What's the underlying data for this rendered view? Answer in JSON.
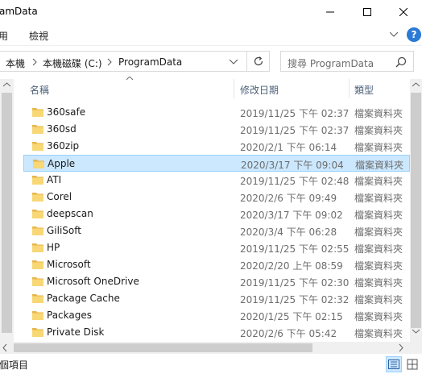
{
  "window": {
    "title": "amData",
    "minimize_label": "—",
    "maximize_label": "□",
    "close_label": "✕"
  },
  "ribbon": {
    "tabs": [
      "用",
      "檢視"
    ],
    "help_label": "?"
  },
  "address": {
    "crumbs": [
      "本機",
      "本機磁碟 (C:)",
      "ProgramData"
    ]
  },
  "search": {
    "placeholder": "搜尋 ProgramData"
  },
  "columns": {
    "name": "名稱",
    "date": "修改日期",
    "type": "類型"
  },
  "files": [
    {
      "name": "360safe",
      "date": "2019/11/25 下午 02:37",
      "type": "檔案資料夾",
      "selected": false
    },
    {
      "name": "360sd",
      "date": "2019/11/25 下午 02:37",
      "type": "檔案資料夾",
      "selected": false
    },
    {
      "name": "360zip",
      "date": "2020/2/1 下午 06:14",
      "type": "檔案資料夾",
      "selected": false
    },
    {
      "name": "Apple",
      "date": "2020/3/17 下午 09:04",
      "type": "檔案資料夾",
      "selected": true
    },
    {
      "name": "ATI",
      "date": "2019/11/25 下午 02:48",
      "type": "檔案資料夾",
      "selected": false
    },
    {
      "name": "Corel",
      "date": "2020/2/6 下午 09:49",
      "type": "檔案資料夾",
      "selected": false
    },
    {
      "name": "deepscan",
      "date": "2020/3/17 下午 09:02",
      "type": "檔案資料夾",
      "selected": false
    },
    {
      "name": "GiliSoft",
      "date": "2020/3/4 下午 06:28",
      "type": "檔案資料夾",
      "selected": false
    },
    {
      "name": "HP",
      "date": "2019/11/25 下午 02:55",
      "type": "檔案資料夾",
      "selected": false
    },
    {
      "name": "Microsoft",
      "date": "2020/2/20 上午 08:59",
      "type": "檔案資料夾",
      "selected": false
    },
    {
      "name": "Microsoft OneDrive",
      "date": "2019/11/25 下午 02:30",
      "type": "檔案資料夾",
      "selected": false
    },
    {
      "name": "Package Cache",
      "date": "2019/11/25 下午 02:32",
      "type": "檔案資料夾",
      "selected": false
    },
    {
      "name": "Packages",
      "date": "2020/1/25 下午 02:15",
      "type": "檔案資料夾",
      "selected": false
    },
    {
      "name": "Private Disk",
      "date": "2020/2/6 下午 05:42",
      "type": "檔案資料夾",
      "selected": false
    }
  ],
  "status": {
    "text": "個項目"
  },
  "icons": {
    "folder": "folder-icon",
    "search": "search-icon",
    "refresh": "refresh-icon",
    "chevron": "chevron-down-icon",
    "details_view": "details-view-icon",
    "large_icons_view": "large-icons-view-icon"
  },
  "colors": {
    "selection_bg": "#cce8ff",
    "selection_border": "#99d1ff",
    "folder_yellow": "#f8d775",
    "help_blue": "#2a7ad6",
    "column_header_text": "#4c607a"
  }
}
